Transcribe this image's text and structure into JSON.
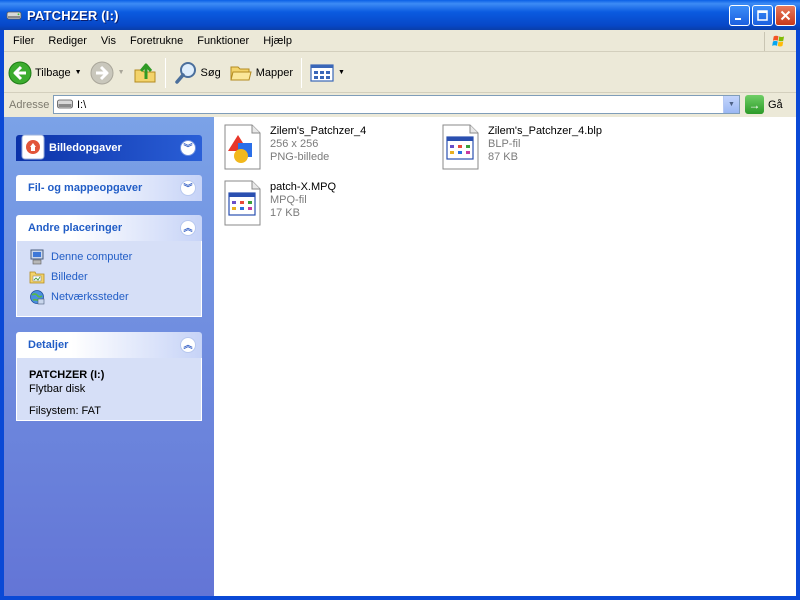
{
  "window": {
    "title": "PATCHZER (I:)"
  },
  "menu": {
    "items": [
      "Filer",
      "Rediger",
      "Vis",
      "Foretrukne",
      "Funktioner",
      "Hjælp"
    ]
  },
  "toolbar": {
    "back_label": "Tilbage",
    "search_label": "Søg",
    "folders_label": "Mapper"
  },
  "address": {
    "label": "Adresse",
    "value": "I:\\",
    "go_label": "Gå"
  },
  "taskpane": {
    "special_panel": {
      "title": "Billedopgaver"
    },
    "file_panel": {
      "title": "Fil- og mappeopgaver"
    },
    "places_panel": {
      "title": "Andre placeringer",
      "links": [
        {
          "label": "Denne computer",
          "icon": "computer-icon"
        },
        {
          "label": "Billeder",
          "icon": "pictures-folder-icon"
        },
        {
          "label": "Netværkssteder",
          "icon": "network-places-icon"
        }
      ]
    },
    "details_panel": {
      "title": "Detaljer",
      "name": "PATCHZER (I:)",
      "type": "Flytbar disk",
      "filesystem": "Filsystem: FAT"
    }
  },
  "files": [
    {
      "name": "Zilem's_Patchzer_4",
      "line2": "256 x 256",
      "line3": "PNG-billede",
      "icon": "png-image-icon"
    },
    {
      "name": "Zilem's_Patchzer_4.blp",
      "line2": "BLP-fil",
      "line3": "87 KB",
      "icon": "generic-file-icon"
    },
    {
      "name": "patch-X.MPQ",
      "line2": "MPQ-fil",
      "line3": "17 KB",
      "icon": "generic-file-icon"
    }
  ],
  "colors": {
    "titlebar": "#0a5fe6",
    "taskpane": "#7ba2e7",
    "link": "#215dc6"
  }
}
